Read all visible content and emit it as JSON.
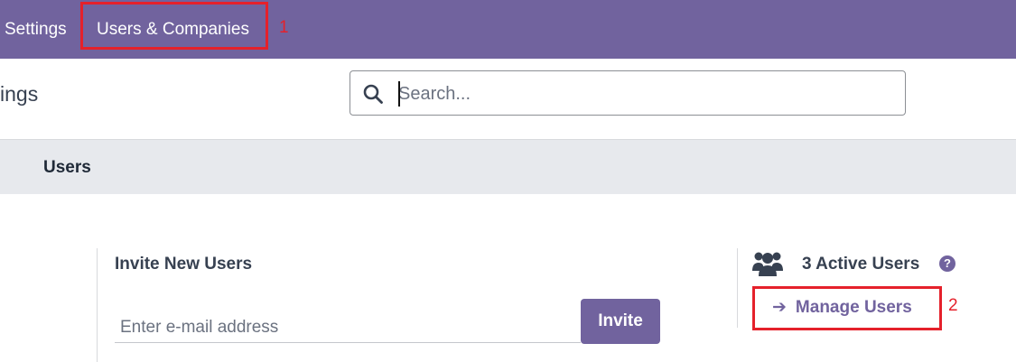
{
  "topbar": {
    "settings_label": "Settings",
    "users_companies_label": "Users & Companies",
    "callout_1": "1",
    "background_color": "#71639e"
  },
  "control_panel": {
    "breadcrumb": "ings",
    "search": {
      "placeholder": "Search...",
      "value": ""
    }
  },
  "section": {
    "title": "Users"
  },
  "invite": {
    "title": "Invite New Users",
    "email_placeholder": "Enter e-mail address",
    "button_label": "Invite"
  },
  "active_users": {
    "label": "3 Active Users",
    "help_icon": "?",
    "manage_label": "Manage Users",
    "manage_arrow": "➔",
    "callout_2": "2"
  },
  "colors": {
    "accent": "#71639e",
    "highlight": "#e5212b",
    "section_bg": "#e7e9ed"
  }
}
